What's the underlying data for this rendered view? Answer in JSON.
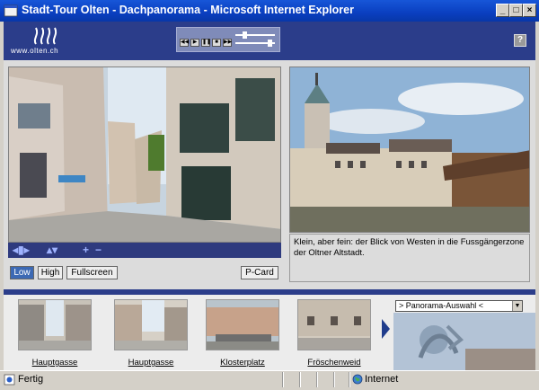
{
  "window": {
    "title": "Stadt-Tour Olten - Dachpanorama - Microsoft Internet Explorer"
  },
  "header": {
    "logo_text": "www.olten.ch",
    "help_label": "?"
  },
  "panorama": {
    "quality_buttons": [
      {
        "label": "Low",
        "active": true
      },
      {
        "label": "High",
        "active": false
      },
      {
        "label": "Fullscreen",
        "active": false
      }
    ],
    "pcard_label": "P-Card"
  },
  "photo": {
    "caption": "Klein, aber fein: der Blick von Westen in die Fussgängerzone der Oltner Altstadt."
  },
  "thumbnails": [
    {
      "label": "Hauptgasse"
    },
    {
      "label": "Hauptgasse"
    },
    {
      "label": "Klosterplatz"
    },
    {
      "label": "Fröschenweid"
    }
  ],
  "panorama_select": {
    "selected": "> Panorama-Auswahl <"
  },
  "statusbar": {
    "status": "Fertig",
    "zone": "Internet"
  },
  "colors": {
    "header": "#2b3d8a",
    "titlebar": "#0a3fc0",
    "active_button": "#3c69b4"
  }
}
